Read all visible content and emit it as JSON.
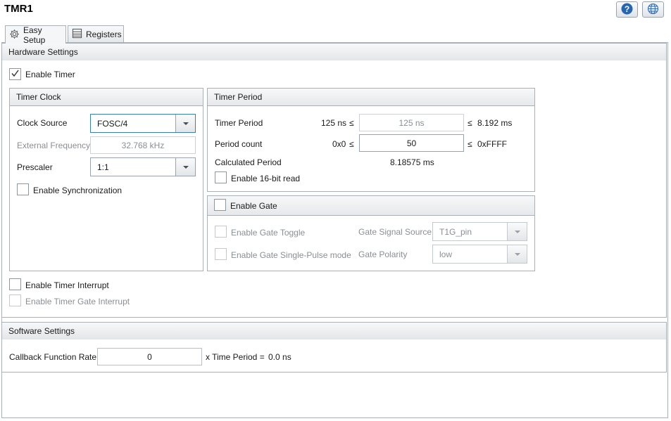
{
  "window": {
    "title": "TMR1",
    "help_icon": "help-icon",
    "globe_icon": "globe-icon"
  },
  "tabs": [
    {
      "label": "Easy Setup",
      "icon": "gear-icon",
      "active": true
    },
    {
      "label": "Registers",
      "icon": "registers-icon",
      "active": false
    }
  ],
  "hardware": {
    "header": "Hardware Settings",
    "enable_timer": {
      "label": "Enable Timer",
      "checked": true
    },
    "timer_clock": {
      "header": "Timer Clock",
      "clock_source": {
        "label": "Clock Source",
        "value": "FOSC/4"
      },
      "external_frequency": {
        "label": "External Frequency",
        "value": "32.768 kHz"
      },
      "prescaler": {
        "label": "Prescaler",
        "value": "1:1"
      },
      "enable_sync": {
        "label": "Enable Synchronization",
        "checked": false
      }
    },
    "timer_period": {
      "header": "Timer Period",
      "period": {
        "label": "Timer Period",
        "min": "125 ns",
        "le1": "≤",
        "value": "125 ns",
        "le2": "≤",
        "max": "8.192 ms"
      },
      "count": {
        "label": "Period count",
        "min": "0x0",
        "le1": "≤",
        "value": "50",
        "le2": "≤",
        "max": "0xFFFF"
      },
      "calculated": {
        "label": "Calculated Period",
        "value": "8.18575 ms"
      },
      "enable_16bit": {
        "label": "Enable 16-bit read",
        "checked": false
      }
    },
    "gate": {
      "header_label": "Enable Gate",
      "enabled": false,
      "toggle": {
        "label": "Enable Gate Toggle"
      },
      "single_pulse": {
        "label": "Enable Gate Single-Pulse mode"
      },
      "signal_source": {
        "label": "Gate Signal Source",
        "value": "T1G_pin"
      },
      "polarity": {
        "label": "Gate Polarity",
        "value": "low"
      }
    },
    "enable_timer_interrupt": {
      "label": "Enable Timer Interrupt",
      "checked": false
    },
    "enable_gate_interrupt": {
      "label": "Enable Timer Gate Interrupt",
      "checked": false
    }
  },
  "software": {
    "header": "Software Settings",
    "callback": {
      "label": "Callback Function Rate",
      "value": "0",
      "suffix": "x Time Period =",
      "result": "0.0 ns"
    }
  },
  "colors": {
    "border": "#a9b0b8",
    "focus": "#3c7fb1",
    "help_blue": "#2466b4"
  }
}
